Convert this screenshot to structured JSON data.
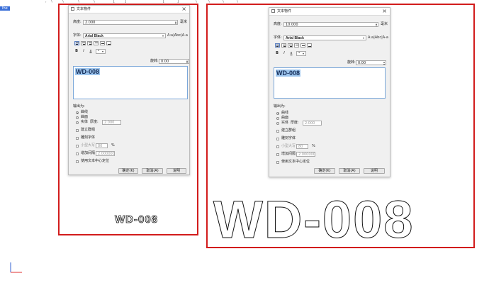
{
  "top_strip": [
    ",",
    "\\",
    "\\",
    "\\",
    "\\",
    "[",
    "]",
    "[",
    "]",
    "\\",
    "\\",
    "\\",
    "\\"
  ],
  "mode_tag": "Ihe",
  "dialogs": [
    {
      "title": "文本物件",
      "height_label": "高度:",
      "height_value": "2.000",
      "unit": "毫米",
      "font_label": "字体:",
      "font_value": "Arial Black",
      "case_buttons": "A:a|Abc|A-a",
      "rotate_label": "旋转:",
      "rotate_value": "0.00",
      "text": "WD-008",
      "output_label": "输出为:",
      "opt_curve": "曲线",
      "opt_surface": "曲面",
      "opt_solid": "实体",
      "thickness_label": "厚度:",
      "thickness_value": "2.000",
      "opt_group": "建立群组",
      "opt_engrave": "雕刻字体",
      "opt_smallcaps": "小型大写",
      "smallcaps_value": "80",
      "percent": "%",
      "opt_spacing": "增加间隔",
      "spacing_value": "2.000000",
      "opt_center": "使用文本中心定位",
      "ok": "确定(K)",
      "cancel": "取消(A)",
      "help": "说明"
    },
    {
      "title": "文本物件",
      "height_label": "高度:",
      "height_value": "10.000",
      "unit": "毫米",
      "font_label": "字体:",
      "font_value": "Arial Black",
      "case_buttons": "A:a|Abc|A-a",
      "rotate_label": "旋转:",
      "rotate_value": "0.00",
      "text": "WD-008",
      "output_label": "输出为:",
      "opt_curve": "曲线",
      "opt_surface": "曲面",
      "opt_solid": "实体",
      "thickness_label": "厚度:",
      "thickness_value": "2.000",
      "opt_group": "建立群组",
      "opt_engrave": "雕刻字体",
      "opt_smallcaps": "小型大写",
      "smallcaps_value": "80",
      "percent": "%",
      "opt_spacing": "增加间隔",
      "spacing_value": "2.000000",
      "opt_center": "使用文本中心定位",
      "ok": "确定(K)",
      "cancel": "取消(A)",
      "help": "说明"
    }
  ],
  "viewport_text_small": "WD-008",
  "viewport_text_large": "WD-008",
  "colors": {
    "highlight_box": "#d21c1c",
    "selection": "#9ec6ee",
    "accent": "#3a6fd8"
  },
  "axes": {
    "x_color": "#e03030",
    "y_color": "#3060d0"
  }
}
